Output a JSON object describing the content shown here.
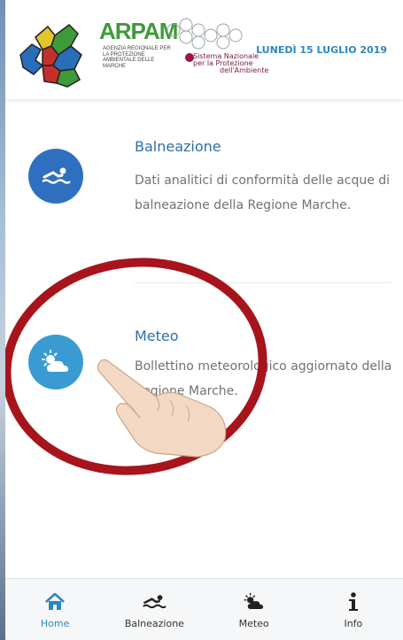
{
  "header": {
    "brand": "ARPAM",
    "brand_sub": "AGENZIA REGIONALE PER LA PROTEZIONE AMBIENTALE DELLE MARCHE",
    "network_lines": [
      "Sistema Nazionale",
      "per la Protezione",
      "dell'Ambiente"
    ],
    "date": "LUNEDÌ 15 LUGLIO 2019"
  },
  "cards": [
    {
      "title": "Balneazione",
      "description": "Dati analitici di conformità delle acque di balneazione della Regione Marche.",
      "icon": "swimmer-icon"
    },
    {
      "title": "Meteo",
      "description": "Bollettino meteorologico aggiornato della Regione Marche.",
      "icon": "sun-cloud-icon"
    }
  ],
  "tabs": [
    {
      "label": "Home",
      "icon": "home-icon",
      "active": true
    },
    {
      "label": "Balneazione",
      "icon": "swimmer-icon",
      "active": false
    },
    {
      "label": "Meteo",
      "icon": "sun-cloud-icon",
      "active": false
    },
    {
      "label": "Info",
      "icon": "info-icon",
      "active": false
    }
  ],
  "colors": {
    "accent": "#2e86c1",
    "title_blue": "#2d6fa8",
    "balneazione_icon_bg": "#2f6fc0",
    "meteo_icon_bg": "#3a9bd2",
    "overlay_ring": "#a8141c",
    "arpam_green": "#3f9a3a"
  }
}
